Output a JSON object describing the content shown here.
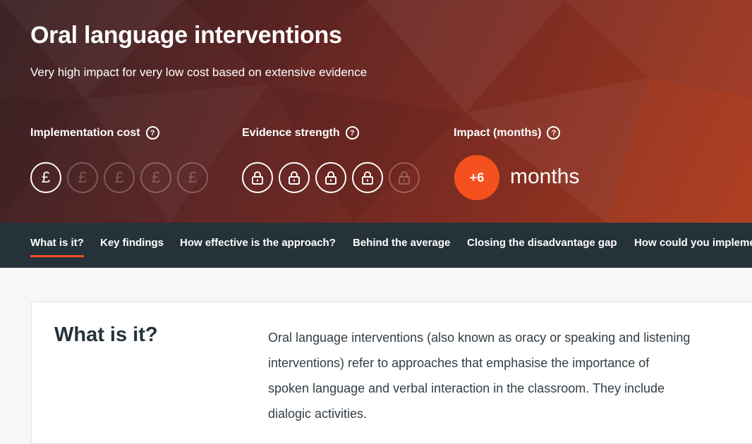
{
  "header": {
    "title": "Oral language interventions",
    "subtitle": "Very high impact for very low cost based on extensive evidence"
  },
  "metrics": {
    "cost": {
      "label": "Implementation cost",
      "symbol": "£",
      "level": 1,
      "max": 5
    },
    "evidence": {
      "label": "Evidence strength",
      "level": 4,
      "max": 5,
      "icon": "padlock-icon"
    },
    "impact": {
      "label": "Impact (months)",
      "value": "+6",
      "unit": "months"
    },
    "help_icon": "question-circle-icon"
  },
  "colors": {
    "accent": "#f4511e",
    "nav_bg": "#26323a",
    "heading": "#26323a"
  },
  "nav": {
    "tabs": [
      {
        "label": "What is it?",
        "active": true
      },
      {
        "label": "Key findings",
        "active": false
      },
      {
        "label": "How effective is the approach?",
        "active": false
      },
      {
        "label": "Behind the average",
        "active": false
      },
      {
        "label": "Closing the disadvantage gap",
        "active": false
      },
      {
        "label": "How could you implement in your setting?",
        "active": false
      }
    ]
  },
  "section": {
    "heading": "What is it?",
    "body": "Oral language interventions (also known as oracy or speaking and listening interventions) refer to approaches that emphasise the importance of spoken language and verbal interaction in the classroom. They include dialogic activities."
  }
}
